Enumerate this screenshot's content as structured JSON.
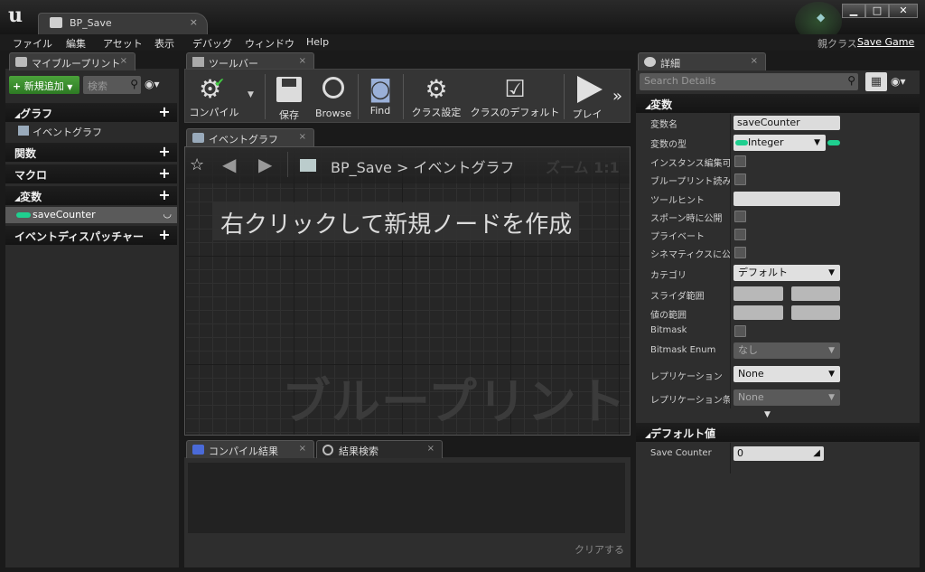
{
  "window": {
    "doc_tab": "BP_Save",
    "close_glyph": "×",
    "min_glyph": "▁",
    "max_glyph": "□",
    "close_win_glyph": "✕"
  },
  "menu": {
    "items": [
      "ファイル",
      "編集",
      "アセット",
      "表示",
      "デバッグ",
      "ウィンドウ",
      "Help"
    ]
  },
  "parent_class": {
    "label": "親クラス",
    "value": "Save Game"
  },
  "my_blueprint": {
    "tab": "マイブループリント",
    "add_new": "新規追加",
    "search_placeholder": "検索",
    "sections": [
      {
        "title": "グラフ",
        "items": [
          "イベントグラフ"
        ]
      },
      {
        "title": "関数"
      },
      {
        "title": "マクロ"
      },
      {
        "title": "変数",
        "items": [
          "saveCounter"
        ]
      },
      {
        "title": "イベントディスパッチャー"
      }
    ]
  },
  "toolbar": {
    "tab": "ツールバー",
    "buttons": [
      "コンパイル",
      "保存",
      "Browse",
      "Find",
      "クラス設定",
      "クラスのデフォルト",
      "プレイ"
    ],
    "more": "»"
  },
  "graph": {
    "tab": "イベントグラフ",
    "breadcrumb_root": "BP_Save",
    "breadcrumb_sep": ">",
    "breadcrumb_leaf": "イベントグラフ",
    "zoom": "ズーム 1:1",
    "hint": "右クリックして新規ノードを作成",
    "watermark": "ブループリント"
  },
  "output": {
    "tab_compile": "コンパイル結果",
    "tab_find": "結果検索",
    "clear": "クリアする"
  },
  "details": {
    "tab": "詳細",
    "search_placeholder": "Search Details",
    "variable_section": "変数",
    "props": {
      "name_label": "変数名",
      "name_value": "saveCounter",
      "type_label": "変数の型",
      "type_value": "Integer",
      "instance_editable": "インスタンス編集可能",
      "bp_readonly": "ブループリント読み取り専用",
      "tooltip": "ツールヒント",
      "expose_spawn": "スポーン時に公開",
      "private": "プライベート",
      "cinematics": "シネマティクスに公開",
      "category_label": "カテゴリ",
      "category_value": "デフォルト",
      "slider_range": "スライダ範囲",
      "value_range": "値の範囲",
      "bitmask": "Bitmask",
      "bitmask_enum_label": "Bitmask Enum",
      "bitmask_enum_value": "なし",
      "replication_label": "レプリケーション",
      "replication_value": "None",
      "rep_condition_label": "レプリケーション条件",
      "rep_condition_value": "None"
    },
    "default_section": "デフォルト値",
    "default_label": "Save Counter",
    "default_value": "0"
  },
  "colors": {
    "accent_green": "#3a9a2e",
    "integer_pin": "#1fcf8f"
  }
}
